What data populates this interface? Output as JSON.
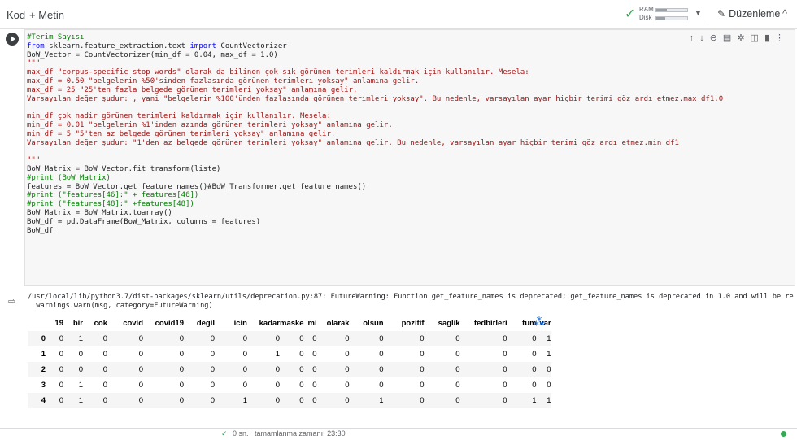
{
  "toolbar": {
    "code_label": "Kod",
    "text_label": "+ Metin",
    "ram_label": "RAM",
    "disk_label": "Disk",
    "ram_usage": 0.35,
    "disk_usage": 0.3,
    "edit_label": "Düzenleme"
  },
  "code_lines": [
    "#Terim Sayısı",
    "from sklearn.feature_extraction.text import CountVectorizer",
    "BoW_Vector = CountVectorizer(min_df = 0.04, max_df = 1.0)",
    "\"\"\"",
    "max_df \"corpus-specific stop words\" olarak da bilinen çok sık görünen terimleri kaldırmak için kullanılır. Mesela:",
    "max_df = 0.50 \"belgelerin %50'sinden fazlasında görünen terimleri yoksay\" anlamına gelir.",
    "max_df = 25 \"25'ten fazla belgede görünen terimleri yoksay\" anlamına gelir.",
    "Varsayılan değer şudur: , yani \"belgelerin %100'ünden fazlasında görünen terimleri yoksay\". Bu nedenle, varsayılan ayar hiçbir terimi göz ardı etmez.max_df1.0",
    "",
    "min_df çok nadir görünen terimleri kaldırmak için kullanılır. Mesela:",
    "min_df = 0.01 \"belgelerin %1'inden azında görünen terimleri yoksay\" anlamına gelir.",
    "min_df = 5 \"5'ten az belgede görünen terimleri yoksay\" anlamına gelir.",
    "Varsayılan değer şudur: \"1'den az belgede görünen terimleri yoksay\" anlamına gelir. Bu nedenle, varsayılan ayar hiçbir terimi göz ardı etmez.min_df1",
    "",
    "\"\"\"",
    "BoW_Matrix = BoW_Vector.fit_transform(liste)",
    "#print (BoW_Matrix)",
    "features = BoW_Vector.get_feature_names()#BoW_Transformer.get_feature_names()",
    "#print (\"features[46]:\" + features[46])",
    "#print (\"features[48]:\" +features[48])",
    "BoW_Matrix = BoW_Matrix.toarray()",
    "BoW_df = pd.DataFrame(BoW_Matrix, columns = features)",
    "BoW_df"
  ],
  "output": {
    "warning_lines": [
      "/usr/local/lib/python3.7/dist-packages/sklearn/utils/deprecation.py:87: FutureWarning: Function get_feature_names is deprecated; get_feature_names is deprecated in 1.0 and will be re",
      "  warnings.warn(msg, category=FutureWarning)"
    ],
    "table": {
      "columns": [
        "19",
        "bir",
        "cok",
        "covid",
        "covid19",
        "degil",
        "icin",
        "kadar",
        "maske",
        "mi",
        "olarak",
        "olsun",
        "pozitif",
        "saglik",
        "tedbirleri",
        "tum",
        "var"
      ],
      "rows": [
        {
          "index": "0",
          "values": [
            "0",
            "1",
            "0",
            "0",
            "0",
            "0",
            "0",
            "0",
            "0",
            "0",
            "0",
            "0",
            "0",
            "0",
            "0",
            "0",
            "1"
          ]
        },
        {
          "index": "1",
          "values": [
            "0",
            "0",
            "0",
            "0",
            "0",
            "0",
            "0",
            "1",
            "0",
            "0",
            "0",
            "0",
            "0",
            "0",
            "0",
            "0",
            "1"
          ]
        },
        {
          "index": "2",
          "values": [
            "0",
            "0",
            "0",
            "0",
            "0",
            "0",
            "0",
            "0",
            "0",
            "0",
            "0",
            "0",
            "0",
            "0",
            "0",
            "0",
            "0"
          ]
        },
        {
          "index": "3",
          "values": [
            "0",
            "1",
            "0",
            "0",
            "0",
            "0",
            "0",
            "0",
            "0",
            "0",
            "0",
            "0",
            "0",
            "0",
            "0",
            "0",
            "0"
          ]
        },
        {
          "index": "4",
          "values": [
            "0",
            "1",
            "0",
            "0",
            "0",
            "0",
            "1",
            "0",
            "0",
            "0",
            "0",
            "1",
            "0",
            "0",
            "0",
            "1",
            "1"
          ]
        }
      ]
    }
  },
  "status": {
    "runtime": "0 sn.",
    "completed_label": "tamamlanma zamanı: 23:30"
  },
  "colors": {
    "accent_green": "#34a853",
    "wand_blue": "#1a73e8"
  }
}
